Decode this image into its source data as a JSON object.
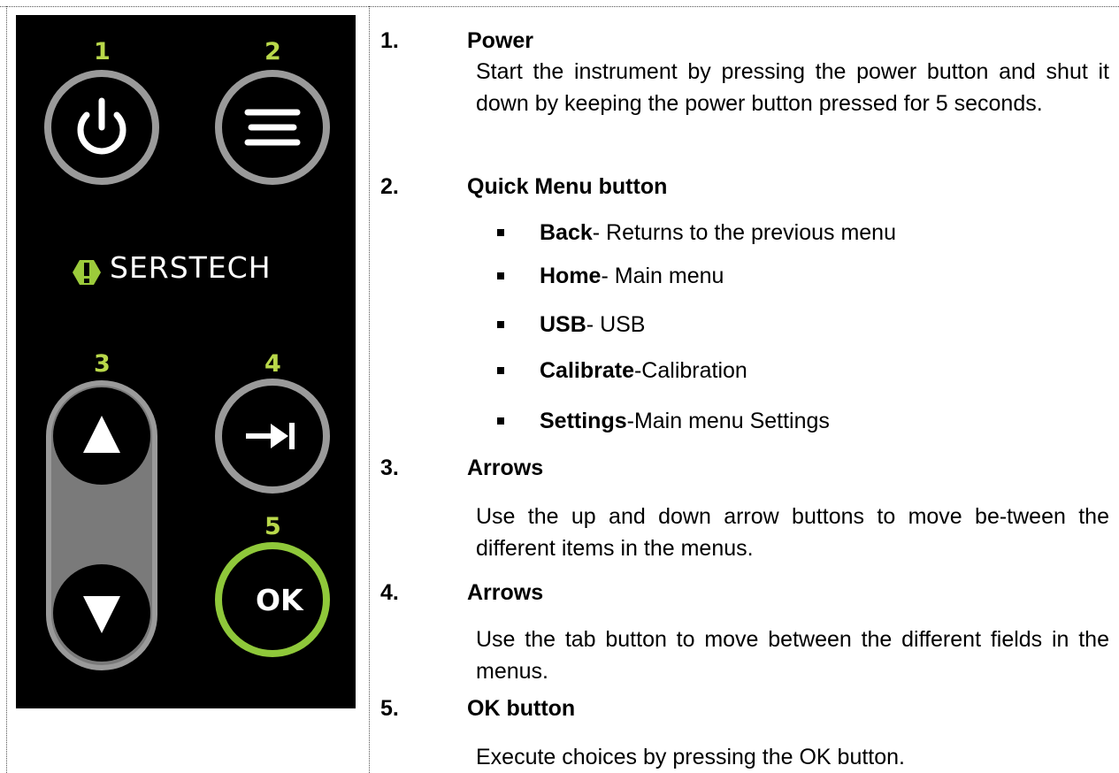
{
  "keypad": {
    "numbers": [
      "1",
      "2",
      "3",
      "4",
      "5"
    ],
    "brand": "SERSTECH",
    "ok_label": "OK",
    "icons": [
      "power-icon",
      "menu-icon",
      "arrow-up-icon",
      "tab-icon",
      "arrow-down-icon"
    ],
    "colors": {
      "panel": "#000000",
      "accent": "#b9d84a",
      "ring": "#9a9a9a",
      "ok_ring": "#8fc83a"
    }
  },
  "sections": [
    {
      "number": "1.",
      "title": "Power",
      "text": "Start the instrument by pressing the power button and shut it down by keeping the power button pressed for 5 seconds."
    },
    {
      "number": "2.",
      "title": "Quick Menu button",
      "bullets": [
        {
          "term": "Back",
          "desc": "- Returns to the previous menu"
        },
        {
          "term": "Home",
          "desc": "- Main menu"
        },
        {
          "term": "USB",
          "desc": "- USB"
        },
        {
          "term": "Calibrate",
          "desc": "-Calibration"
        },
        {
          "term": "Settings",
          "desc": "-Main menu Settings"
        }
      ]
    },
    {
      "number": "3.",
      "title": "Arrows",
      "text": "Use the up and down arrow buttons to move be-tween the different items in the menus."
    },
    {
      "number": "4.",
      "title": "Arrows",
      "text": "Use the tab button to move between the different fields in the menus."
    },
    {
      "number": "5.",
      "title": "OK button",
      "text": "Execute choices by pressing the OK button."
    }
  ]
}
